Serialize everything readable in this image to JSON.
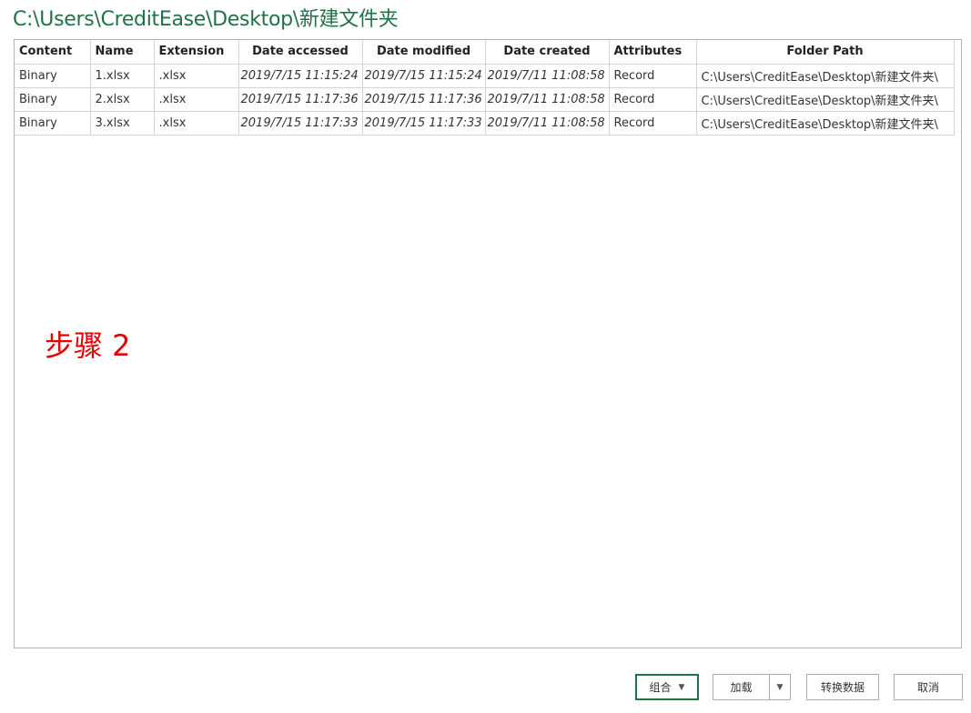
{
  "title": "C:\\Users\\CreditEase\\Desktop\\新建文件夹",
  "table": {
    "columns": [
      "Content",
      "Name",
      "Extension",
      "Date accessed",
      "Date modified",
      "Date created",
      "Attributes",
      "Folder Path"
    ],
    "rows": [
      [
        "Binary",
        "1.xlsx",
        ".xlsx",
        "2019/7/15 11:15:24",
        "2019/7/15 11:15:24",
        "2019/7/11 11:08:58",
        "Record",
        "C:\\Users\\CreditEase\\Desktop\\新建文件夹\\"
      ],
      [
        "Binary",
        "2.xlsx",
        ".xlsx",
        "2019/7/15 11:17:36",
        "2019/7/15 11:17:36",
        "2019/7/11 11:08:58",
        "Record",
        "C:\\Users\\CreditEase\\Desktop\\新建文件夹\\"
      ],
      [
        "Binary",
        "3.xlsx",
        ".xlsx",
        "2019/7/15 11:17:33",
        "2019/7/15 11:17:33",
        "2019/7/11 11:08:58",
        "Record",
        "C:\\Users\\CreditEase\\Desktop\\新建文件夹\\"
      ]
    ]
  },
  "annotation": "步骤 2",
  "buttons": {
    "combine": "组合",
    "load": "加载",
    "transform": "转换数据",
    "cancel": "取消"
  },
  "icons": {
    "combine_dropdown": "chevron-down-icon",
    "load_dropdown": "chevron-down-icon"
  },
  "colors": {
    "title": "#217346",
    "annotation": "#e60000",
    "combine_border": "#217346"
  }
}
